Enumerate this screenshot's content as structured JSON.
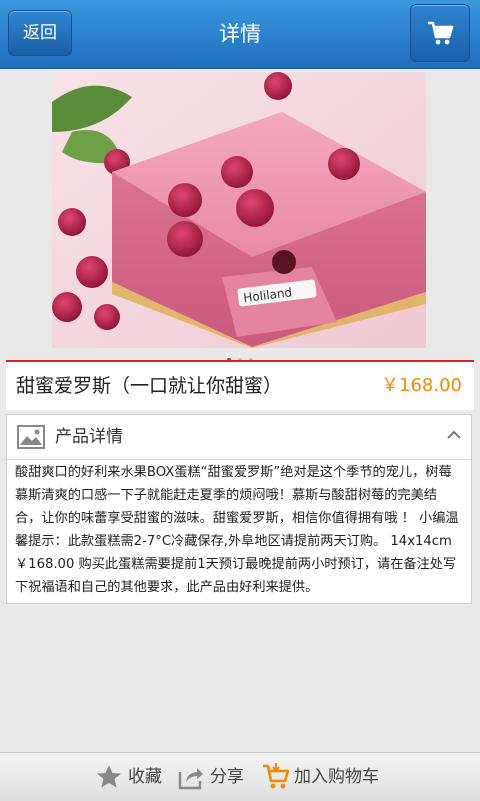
{
  "header": {
    "back_label": "返回",
    "title": "详情"
  },
  "carousel": {
    "image_alt_brand": "Holiland",
    "pages": 3,
    "active_page": 1
  },
  "product": {
    "name": "甜蜜爱罗斯（一口就让你甜蜜）",
    "price": "￥168.00"
  },
  "details": {
    "title": "产品详情",
    "text": "酸甜爽口的好利来水果BOX蛋糕“甜蜜爱罗斯”绝对是这个季节的宠儿，树莓慕斯清爽的口感一下子就能赶走夏季的烦闷哦！慕斯与酸甜树莓的完美结合，让你的味蕾享受甜蜜的滋味。甜蜜爱罗斯，相信你值得拥有哦 ！ 小编温馨提示：此款蛋糕需2-7°C冷藏保存,外阜地区请提前两天订购。 14x14cm ￥168.00 购买此蛋糕需要提前1天预订最晚提前两小时预订，请在备注处写下祝福语和自己的其他要求，此产品由好利来提供。"
  },
  "bottom": {
    "favorite": "收藏",
    "share": "分享",
    "add_to_cart": "加入购物车"
  },
  "colors": {
    "header_blue": "#2a82d0",
    "accent_red": "#d9201b",
    "price_orange": "#f08a00"
  },
  "icons": [
    "cart-icon",
    "picture-icon",
    "chevron-up-icon",
    "star-icon",
    "share-icon",
    "add-cart-icon"
  ]
}
